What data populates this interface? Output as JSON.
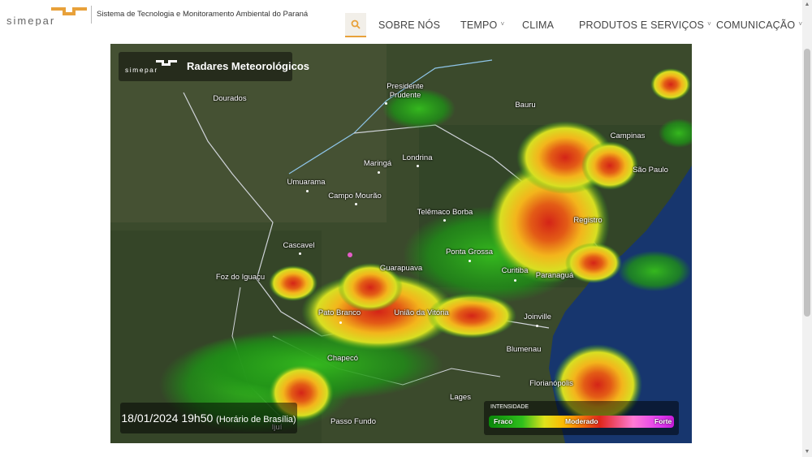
{
  "header": {
    "logo_text": "simepar",
    "subtitle": "Sistema de Tecnologia e Monitoramento Ambiental do Paraná",
    "nav": [
      {
        "label": "SOBRE NÓS",
        "has_dropdown": false
      },
      {
        "label": "TEMPO",
        "has_dropdown": true
      },
      {
        "label": "CLIMA",
        "has_dropdown": false
      },
      {
        "label": "PRODUTOS E SERVIÇOS",
        "has_dropdown": true
      },
      {
        "label": "COMUNICAÇÃO",
        "has_dropdown": true
      }
    ],
    "search_icon": "search-icon",
    "accent_color": "#e8a13a"
  },
  "map": {
    "title": "Radares Meteorológicos",
    "logo_text": "simepar",
    "timestamp": "18/01/2024 19h50",
    "timestamp_note": "(Horário de Brasília)",
    "legend": {
      "title": "INTENSIDADE",
      "low": "Fraco",
      "mid": "Moderado",
      "high": "Forte"
    },
    "cities": [
      "Dourados",
      "Presidente Prudente",
      "Bauru",
      "Campinas",
      "São Paulo",
      "Londrina",
      "Maringá",
      "Umuarama",
      "Campo Mourão",
      "Telêmaco Borba",
      "Registro",
      "Cascavel",
      "Guarapuava",
      "Ponta Grossa",
      "Curitiba",
      "Paranaguá",
      "Foz do Iguaçu",
      "Pato Branco",
      "União da Vitória",
      "Joinville",
      "Chapecó",
      "Blumenau",
      "Florianópolis",
      "Lages",
      "Passo Fundo",
      "Ijuí"
    ]
  }
}
